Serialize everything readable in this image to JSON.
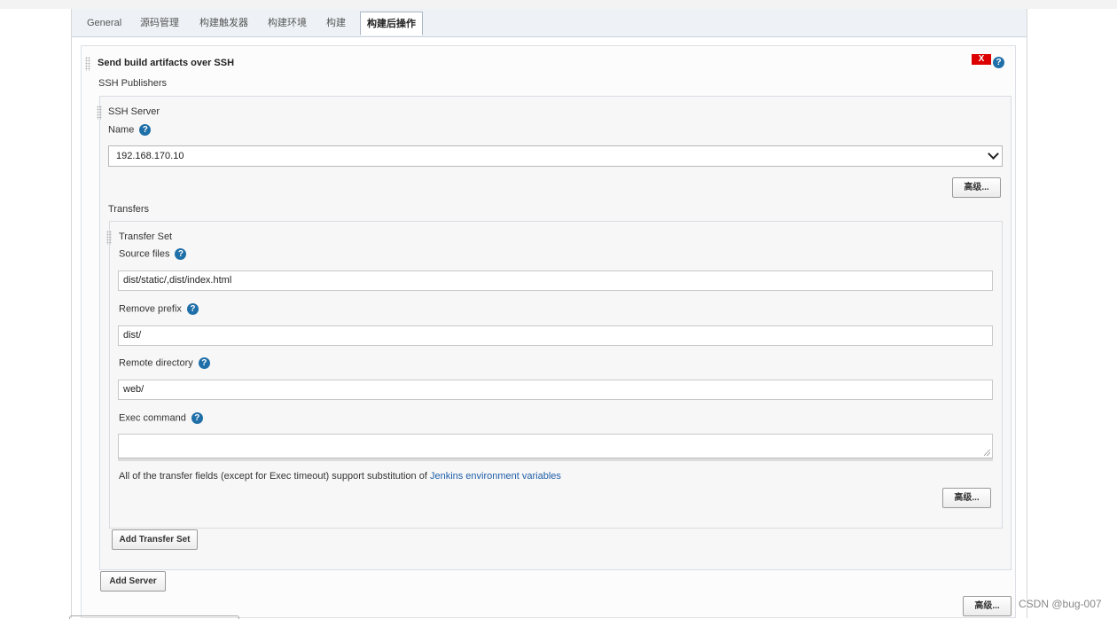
{
  "tabs": [
    "General",
    "源码管理",
    "构建触发器",
    "构建环境",
    "构建",
    "构建后操作"
  ],
  "section": {
    "title": "Send build artifacts over SSH",
    "delete_label": "X",
    "publishers_label": "SSH Publishers"
  },
  "ssh_server": {
    "title": "SSH Server",
    "name_label": "Name",
    "name_value": "192.168.170.10",
    "advanced_label": "高级...",
    "transfers_label": "Transfers"
  },
  "transfer_set": {
    "title": "Transfer Set",
    "source_files_label": "Source files",
    "source_files_value": "dist/static/,dist/index.html",
    "remove_prefix_label": "Remove prefix",
    "remove_prefix_value": "dist/",
    "remote_directory_label": "Remote directory",
    "remote_directory_value": "web/",
    "exec_command_label": "Exec command",
    "exec_command_value": "",
    "note_text": "All of the transfer fields (except for Exec timeout) support substitution of ",
    "note_link": "Jenkins environment variables",
    "advanced_label": "高级..."
  },
  "buttons": {
    "add_transfer_set": "Add Transfer Set",
    "add_server": "Add Server",
    "advanced_bottom": "高级..."
  },
  "help_glyph": "?",
  "watermark": "CSDN @bug-007"
}
